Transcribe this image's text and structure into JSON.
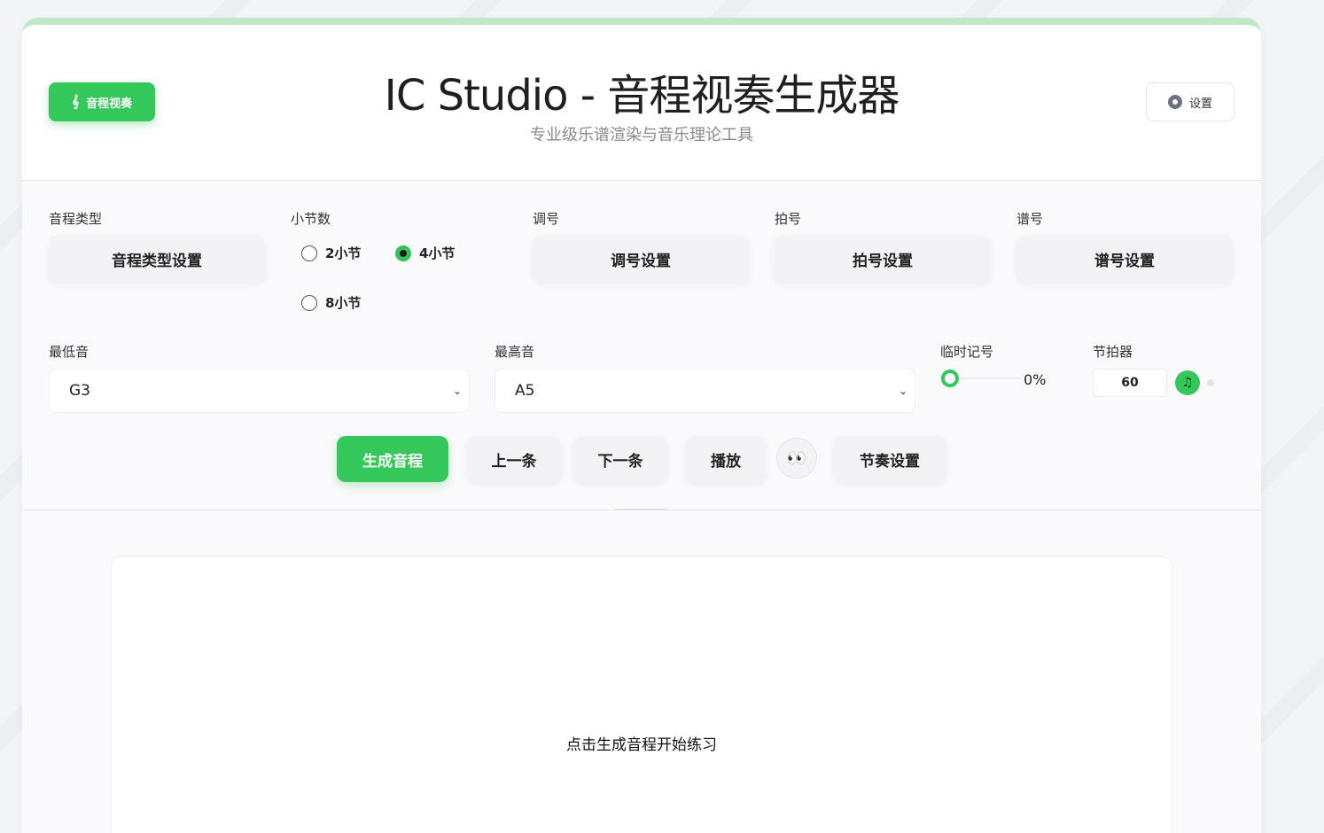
{
  "header": {
    "mode_button": {
      "label": "音程视奏",
      "icon": "treble-clef-icon"
    },
    "title": "IC Studio - 音程视奏生成器",
    "subtitle": "专业级乐谱渲染与音乐理论工具",
    "settings_button": {
      "label": "设置",
      "icon": "gear-icon"
    }
  },
  "controls": {
    "interval_type": {
      "label": "音程类型",
      "button": "音程类型设置"
    },
    "measures": {
      "label": "小节数",
      "options": [
        "2小节",
        "4小节",
        "8小节"
      ],
      "selected": "4小节"
    },
    "key_signature": {
      "label": "调号",
      "button": "调号设置"
    },
    "time_signature": {
      "label": "拍号",
      "button": "拍号设置"
    },
    "clef": {
      "label": "谱号",
      "button": "谱号设置"
    },
    "lowest_note": {
      "label": "最低音",
      "value": "G3"
    },
    "highest_note": {
      "label": "最高音",
      "value": "A5"
    },
    "accidentals": {
      "label": "临时记号",
      "value_text": "0%",
      "value": 0
    },
    "metronome": {
      "label": "节拍器",
      "bpm": "60",
      "icon": "music-note-icon"
    }
  },
  "actions": {
    "generate": "生成音程",
    "previous": "上一条",
    "next": "下一条",
    "play": "播放",
    "toggle_view": "👀",
    "rhythm_settings": "节奏设置"
  },
  "sheet": {
    "placeholder": "点击生成音程开始练习"
  },
  "colors": {
    "accent": "#34c759",
    "top_bar": "#bde9c9",
    "background": "#fafafc"
  }
}
